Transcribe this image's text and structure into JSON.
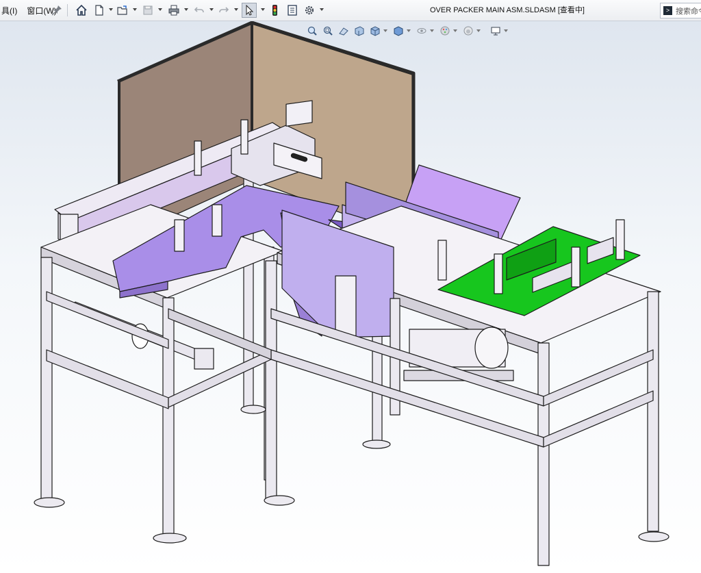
{
  "menu": {
    "left_item_suffix": "具(I)",
    "window_menu": "窗口(W)"
  },
  "toolbar": {
    "icons": [
      "pin-icon",
      "home-icon",
      "new-document-icon",
      "open-folder-icon",
      "save-icon",
      "print-icon",
      "undo-icon",
      "redo-icon",
      "select-arrow-icon",
      "rebuild-icon",
      "file-properties-icon",
      "options-gear-icon"
    ]
  },
  "document": {
    "title": "OVER PACKER MAIN ASM.SLDASM [查看中]"
  },
  "search": {
    "placeholder": "搜索命令"
  },
  "heads_up_toolbar": {
    "icons": [
      "zoom-to-fit-icon",
      "zoom-to-area-icon",
      "previous-view-icon",
      "section-view-icon",
      "view-orientation-icon",
      "display-style-icon",
      "hide-show-items-icon",
      "edit-appearance-icon",
      "apply-scene-icon",
      "view-settings-icon"
    ]
  },
  "colors": {
    "frame": "#eceaf2",
    "purple_panel": "#a98ee8",
    "light_purple": "#d9c8ec",
    "green_belt": "#17c61e",
    "back_panel_left": "#9b8578",
    "back_panel_right": "#bea68c"
  }
}
